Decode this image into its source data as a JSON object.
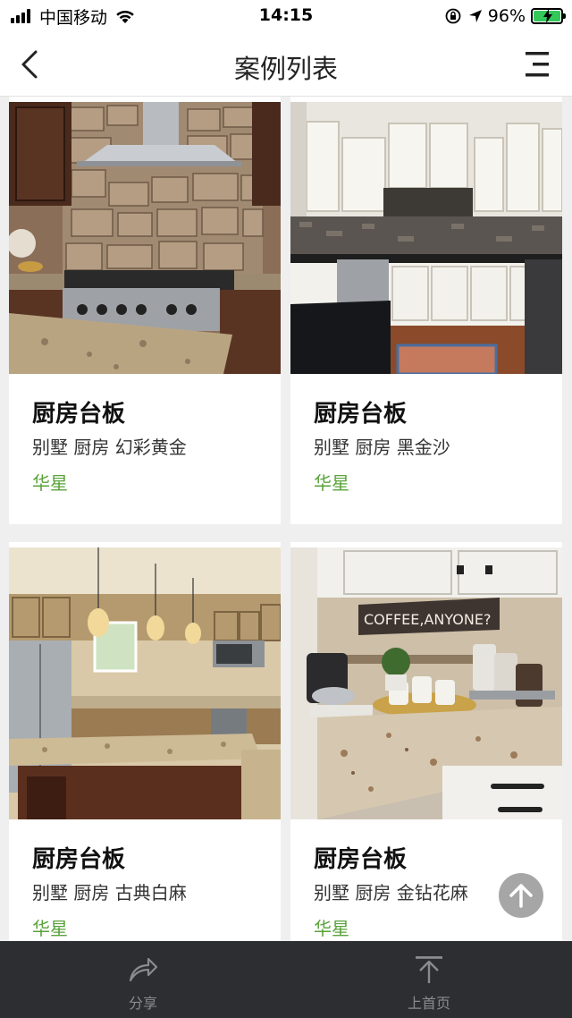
{
  "status_bar": {
    "carrier": "中国移动",
    "time": "14:15",
    "battery": "96%",
    "battery_level": 0.96
  },
  "nav": {
    "title": "案例列表",
    "back_icon": "chevron-left-icon",
    "menu_icon": "menu-icon"
  },
  "cards": [
    {
      "title": "厨房台板",
      "desc": "别墅 厨房 幻彩黄金",
      "brand": "华星"
    },
    {
      "title": "厨房台板",
      "desc": "别墅 厨房 黑金沙",
      "brand": "华星"
    },
    {
      "title": "厨房台板",
      "desc": "别墅 厨房 古典白麻",
      "brand": "华星"
    },
    {
      "title": "厨房台板",
      "desc": "别墅 厨房 金钻花麻",
      "brand": "华星"
    }
  ],
  "photo_text": {
    "sign": "COFFEE,ANYONE?"
  },
  "bottom_bar": {
    "share_label": "分享",
    "home_label": "上首页"
  },
  "colors": {
    "brand_green": "#5aa33a",
    "bottom_bar_bg": "#2d2e31"
  }
}
